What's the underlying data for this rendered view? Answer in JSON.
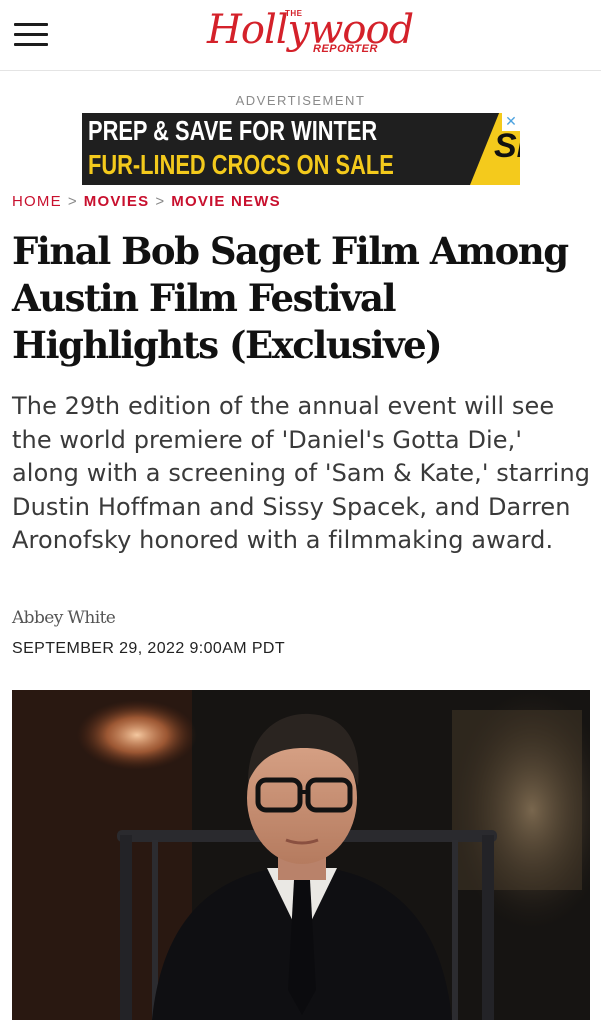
{
  "header": {
    "menu_icon": "hamburger-menu-icon",
    "logo": {
      "the": "THE",
      "script": "Hollywood",
      "sub": "REPORTER",
      "color": "#d4212a"
    }
  },
  "advertisement": {
    "label": "ADVERTISEMENT",
    "line1": "PREP & SAVE FOR WINTER",
    "line2": "FUR-LINED CROCS ON SALE",
    "brand": "SPY",
    "close_glyph": "✕",
    "line1_color": "#ffffff",
    "line2_color": "#f4ca1c"
  },
  "breadcrumb": {
    "items": [
      "HOME",
      "MOVIES",
      "MOVIE NEWS"
    ],
    "separator": ">",
    "accent_color": "#c8102e",
    "home_color": "#c8102e"
  },
  "article": {
    "headline": "Final Bob Saget Film Among Austin Film Festival Highlights (Exclusive)",
    "dek": "The 29th edition of the annual event will see the world premiere of 'Daniel's Gotta Die,' along with a screening of 'Sam & Kate,' starring Dustin Hoffman and Sissy Spacek, and Darren Aronofsky honored with a filmmaking award.",
    "author": "Abbey White",
    "date": "SEPTEMBER 29, 2022 9:00AM PDT"
  }
}
